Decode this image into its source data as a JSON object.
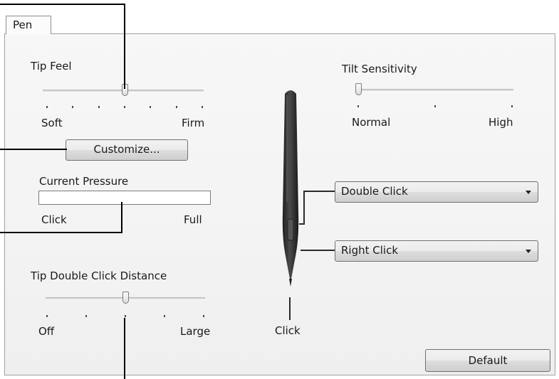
{
  "tabs": [
    {
      "label": "Pen",
      "selected": true
    }
  ],
  "tip_feel": {
    "label": "Tip Feel",
    "min_label": "Soft",
    "max_label": "Firm",
    "level_fraction": 0.5,
    "tick_count": 7,
    "customize_button": "Customize..."
  },
  "current_pressure": {
    "label": "Current Pressure",
    "min_label": "Click",
    "max_label": "Full",
    "level_fraction": 0
  },
  "tip_double_click_distance": {
    "label": "Tip Double Click Distance",
    "min_label": "Off",
    "max_label": "Large",
    "level_fraction": 0.5,
    "tick_count": 5
  },
  "tilt_sensitivity": {
    "label": "Tilt Sensitivity",
    "min_label": "Normal",
    "max_label": "High",
    "level_fraction": 0,
    "tick_count": 3
  },
  "pen_buttons": {
    "upper": "Double Click",
    "lower": "Right Click",
    "tip": "Click"
  },
  "default_button": "Default",
  "colors": {
    "pen_body": "#3a3a3a",
    "callout_line": "#000000",
    "panel_bg": "#f4f4f4"
  }
}
